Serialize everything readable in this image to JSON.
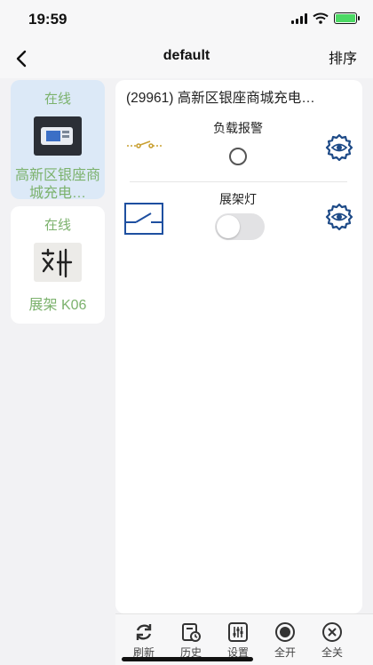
{
  "status_bar": {
    "time": "19:59"
  },
  "nav": {
    "title": "default",
    "sort_label": "排序"
  },
  "devices": [
    {
      "status": "在线",
      "name": "高新区银座商城充电…",
      "active": true
    },
    {
      "status": "在线",
      "name": "展架 K06",
      "active": false
    }
  ],
  "panel": {
    "title": "(29961) 高新区银座商城充电…",
    "controls": [
      {
        "label": "负载报警",
        "type": "radio",
        "selected": false
      },
      {
        "label": "展架灯",
        "type": "toggle",
        "on": false
      }
    ]
  },
  "tabs": [
    {
      "label": "刷新",
      "icon": "refresh-icon"
    },
    {
      "label": "历史",
      "icon": "history-icon"
    },
    {
      "label": "设置",
      "icon": "settings-sliders-icon"
    },
    {
      "label": "全开",
      "icon": "radio-filled-icon"
    },
    {
      "label": "全关",
      "icon": "close-circle-icon"
    }
  ],
  "colors": {
    "online_green": "#7cb26d",
    "active_card": "#dce9f7",
    "switch_blue": "#1e4fa0",
    "gear_blue": "#1d4a87"
  }
}
